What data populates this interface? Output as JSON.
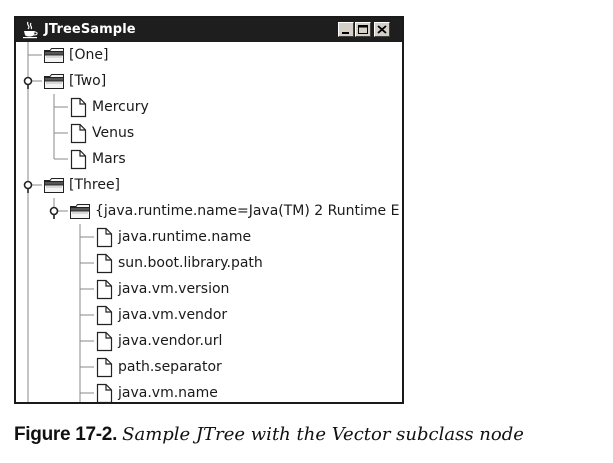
{
  "window": {
    "title": "JTreeSample",
    "controls": [
      "minimize",
      "maximize",
      "close"
    ]
  },
  "tree": {
    "nodes": [
      {
        "label": "[One]",
        "type": "folder",
        "depth": 0
      },
      {
        "label": "[Two]",
        "type": "folder",
        "depth": 0,
        "expanded": true
      },
      {
        "label": "Mercury",
        "type": "leaf",
        "depth": 1
      },
      {
        "label": "Venus",
        "type": "leaf",
        "depth": 1
      },
      {
        "label": "Mars",
        "type": "leaf",
        "depth": 1
      },
      {
        "label": "[Three]",
        "type": "folder",
        "depth": 0,
        "expanded": true
      },
      {
        "label": "{java.runtime.name=Java(TM) 2 Runtime E",
        "type": "folder",
        "depth": 1,
        "expanded": true
      },
      {
        "label": "java.runtime.name",
        "type": "leaf",
        "depth": 2
      },
      {
        "label": "sun.boot.library.path",
        "type": "leaf",
        "depth": 2
      },
      {
        "label": "java.vm.version",
        "type": "leaf",
        "depth": 2
      },
      {
        "label": "java.vm.vendor",
        "type": "leaf",
        "depth": 2
      },
      {
        "label": "java.vendor.url",
        "type": "leaf",
        "depth": 2
      },
      {
        "label": "path.separator",
        "type": "leaf",
        "depth": 2
      },
      {
        "label": "java.vm.name",
        "type": "leaf",
        "depth": 2
      }
    ]
  },
  "caption": {
    "figure_number": "Figure 17-2.",
    "text": "Sample JTree with the Vector subclass node"
  }
}
